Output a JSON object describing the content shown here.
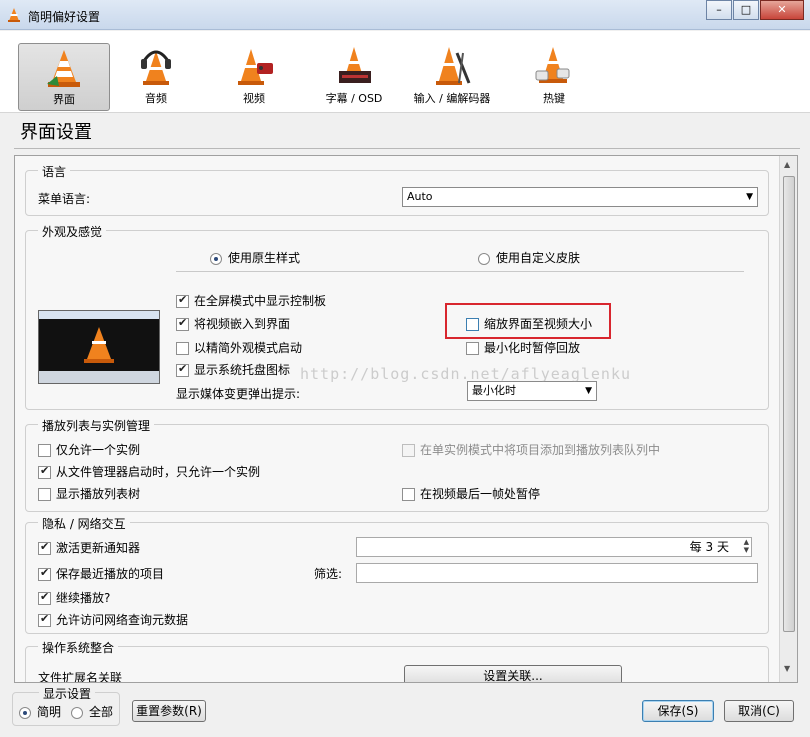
{
  "window": {
    "title": "简明偏好设置",
    "buttons": {
      "minimize": "–",
      "maximize": "□",
      "close": "✕"
    }
  },
  "toolbar": {
    "items": [
      {
        "label": "界面",
        "icon": "cone-interface-icon",
        "active": true
      },
      {
        "label": "音频",
        "icon": "cone-headphones-icon"
      },
      {
        "label": "视频",
        "icon": "cone-video-icon"
      },
      {
        "label": "字幕 / OSD",
        "icon": "cone-subtitle-icon"
      },
      {
        "label": "输入 / 编解码器",
        "icon": "cone-input-codec-icon"
      },
      {
        "label": "热键",
        "icon": "cone-hotkey-icon"
      }
    ]
  },
  "page_title": "界面设置",
  "groups": {
    "language": {
      "title": "语言",
      "menu_language_label": "菜单语言:",
      "menu_language_value": "Auto"
    },
    "look_feel": {
      "title": "外观及感觉",
      "radio_native": "使用原生样式",
      "radio_custom": "使用自定义皮肤",
      "options": {
        "fullscreen_controls": "在全屏模式中显示控制板",
        "embed_video": "将视频嵌入到界面",
        "minimal_view": "以精简外观模式启动",
        "systray": "显示系统托盘图标",
        "resize_to_video": "缩放界面至视频大小",
        "pause_minimized": "最小化时暂停回放"
      },
      "popup_label": "显示媒体变更弹出提示:",
      "popup_value": "最小化时"
    },
    "playlist": {
      "title": "播放列表与实例管理",
      "one_instance": "仅允许一个实例",
      "enqueue_one_instance": "在单实例模式中将项目添加到播放列表队列中",
      "one_instance_file_manager": "从文件管理器启动时，只允许一个实例",
      "show_playlist_tree": "显示播放列表树",
      "pause_last_frame": "在视频最后一帧处暂停"
    },
    "privacy": {
      "title": "隐私 / 网络交互",
      "update_notifier": "激活更新通知器",
      "update_every": "每",
      "update_days": "3",
      "update_unit": "天",
      "save_recent": "保存最近播放的项目",
      "filter_label": "筛选:",
      "continue_playback": "继续播放?",
      "metadata_network": "允许访问网络查询元数据"
    },
    "os": {
      "title": "操作系统整合",
      "file_assoc_label": "文件扩展名关联",
      "setup_assoc_button": "设置关联..."
    }
  },
  "footer": {
    "show_settings_title": "显示设置",
    "simple": "简明",
    "all": "全部",
    "reset_button": "重置参数(R)",
    "save_button": "保存(S)",
    "cancel_button": "取消(C)"
  },
  "watermark": "http://blog.csdn.net/aflyeaglenku",
  "colors": {
    "cone_orange": "#f0821e",
    "highlight_red": "#d8262e",
    "accent_blue": "#3c7fb1"
  }
}
